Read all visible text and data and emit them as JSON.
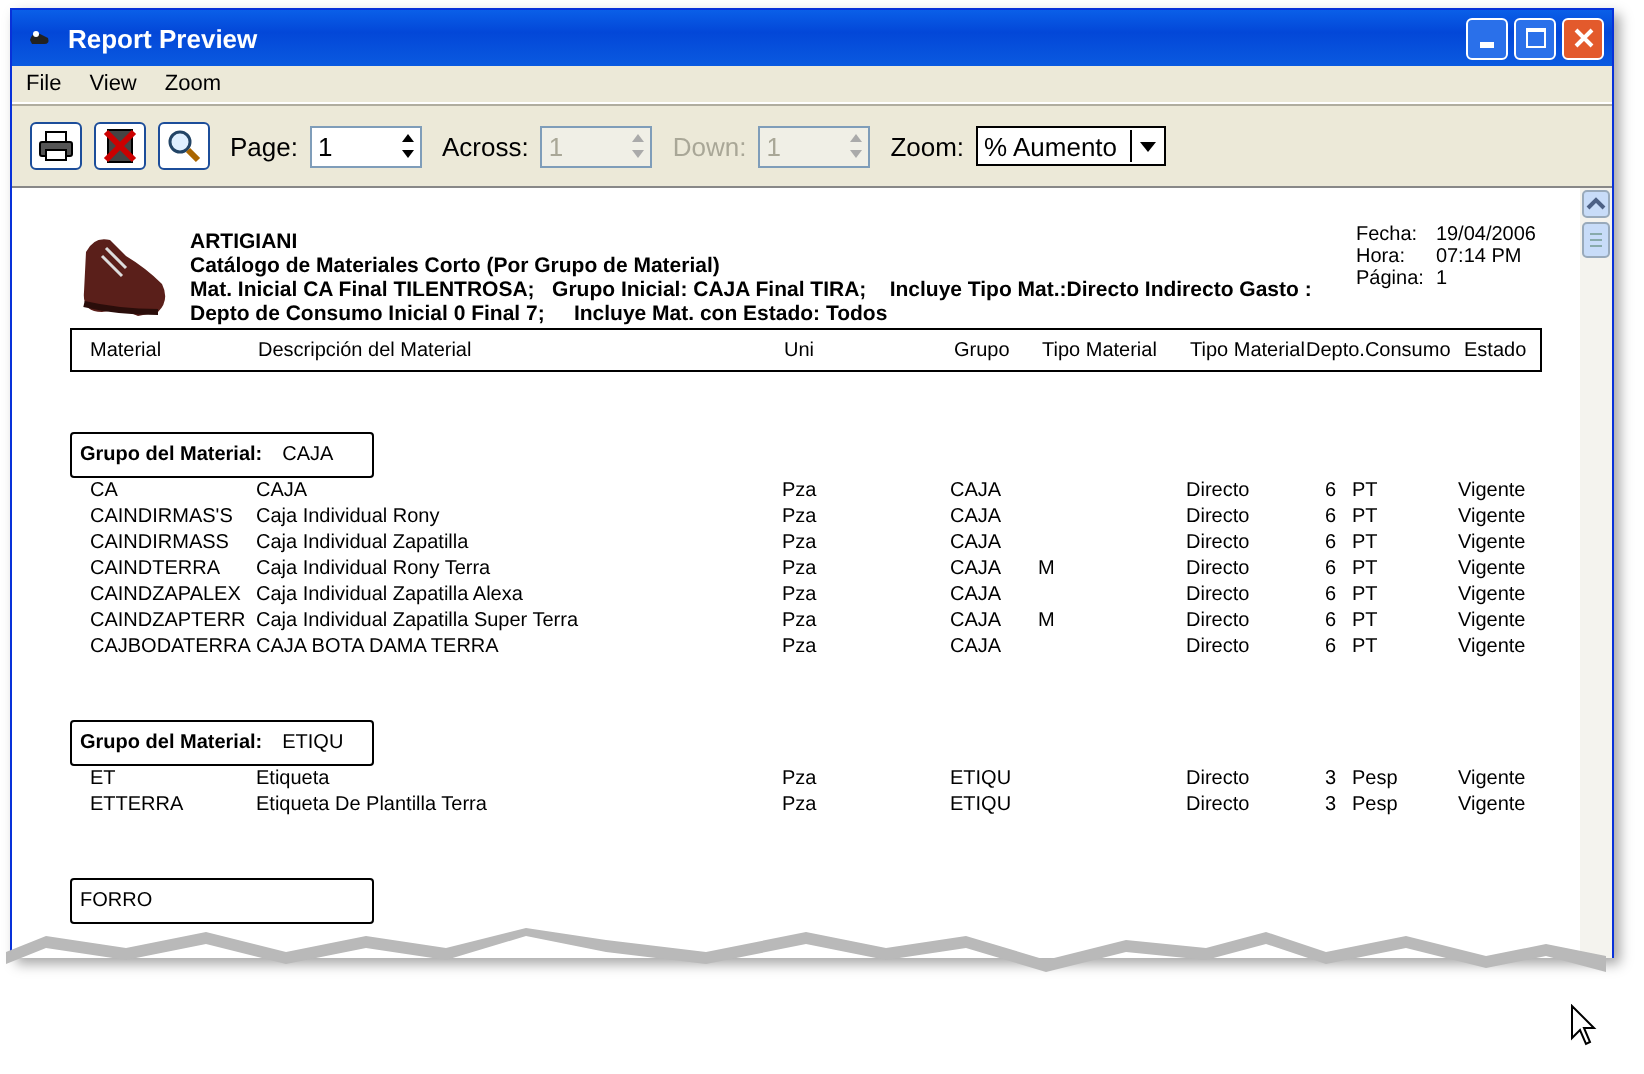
{
  "window": {
    "title": "Report Preview"
  },
  "menu": [
    "File",
    "View",
    "Zoom"
  ],
  "toolbar": {
    "buttons": [
      {
        "kind": "print"
      },
      {
        "kind": "close"
      },
      {
        "kind": "zoom"
      }
    ],
    "spinners": [
      {
        "label": "Page:",
        "value": "1",
        "disabled": false,
        "label_disabled": false
      },
      {
        "label": "Across:",
        "value": "1",
        "disabled": true,
        "label_disabled": false
      },
      {
        "label": "Down:",
        "value": "1",
        "disabled": true,
        "label_disabled": true
      }
    ],
    "zoom": {
      "label": "Zoom:",
      "value": "% Aumento"
    }
  },
  "report": {
    "company": "ARTIGIANI",
    "title": "Catálogo de Materiales Corto (Por Grupo de Material)",
    "lines": [
      "Mat. Inicial CA Final TILENTROSA;   Grupo Inicial: CAJA Final TIRA;    Incluye Tipo Mat.:Directo Indirecto Gasto :",
      "Depto de Consumo Inicial 0 Final 7;     Incluye Mat. con Estado: Todos"
    ],
    "info": [
      {
        "label": "Fecha:",
        "value": "19/04/2006"
      },
      {
        "label": "Hora:",
        "value": "07:14 PM"
      },
      {
        "label": "Página:",
        "value": "1"
      }
    ],
    "columns": [
      "Material",
      "Descripción del Material",
      "Uni",
      "Grupo",
      "Tipo Material",
      "Tipo Material",
      "Depto.Consumo",
      "Estado"
    ],
    "groups": [
      {
        "label": "Grupo del Material:",
        "name": "CAJA",
        "rows": [
          [
            "CA",
            "CAJA",
            "Pza",
            "CAJA",
            "",
            "Directo",
            "6",
            "PT",
            "Vigente"
          ],
          [
            "CAINDIRMAS'S",
            "Caja Individual Rony",
            "Pza",
            "CAJA",
            "",
            "Directo",
            "6",
            "PT",
            "Vigente"
          ],
          [
            "CAINDIRMASS",
            "Caja Individual Zapatilla",
            "Pza",
            "CAJA",
            "",
            "Directo",
            "6",
            "PT",
            "Vigente"
          ],
          [
            "CAINDTERRA",
            "Caja Individual Rony Terra",
            "Pza",
            "CAJA",
            "M",
            "Directo",
            "6",
            "PT",
            "Vigente"
          ],
          [
            "CAINDZAPALEX",
            "Caja Individual Zapatilla Alexa",
            "Pza",
            "CAJA",
            "",
            "Directo",
            "6",
            "PT",
            "Vigente"
          ],
          [
            "CAINDZAPTERR",
            "Caja Individual Zapatilla Super Terra",
            "Pza",
            "CAJA",
            "M",
            "Directo",
            "6",
            "PT",
            "Vigente"
          ],
          [
            "CAJBODATERRA",
            "CAJA BOTA DAMA TERRA",
            "Pza",
            "CAJA",
            "",
            "Directo",
            "6",
            "PT",
            "Vigente"
          ]
        ]
      },
      {
        "label": "Grupo del Material:",
        "name": "ETIQU",
        "rows": [
          [
            "ET",
            "Etiqueta",
            "Pza",
            "ETIQU",
            "",
            "Directo",
            "3",
            "Pesp",
            "Vigente"
          ],
          [
            "ETTERRA",
            "Etiqueta De Plantilla Terra",
            "Pza",
            "ETIQU",
            "",
            "Directo",
            "3",
            "Pesp",
            "Vigente"
          ]
        ]
      },
      {
        "name": "FORRO"
      }
    ]
  }
}
